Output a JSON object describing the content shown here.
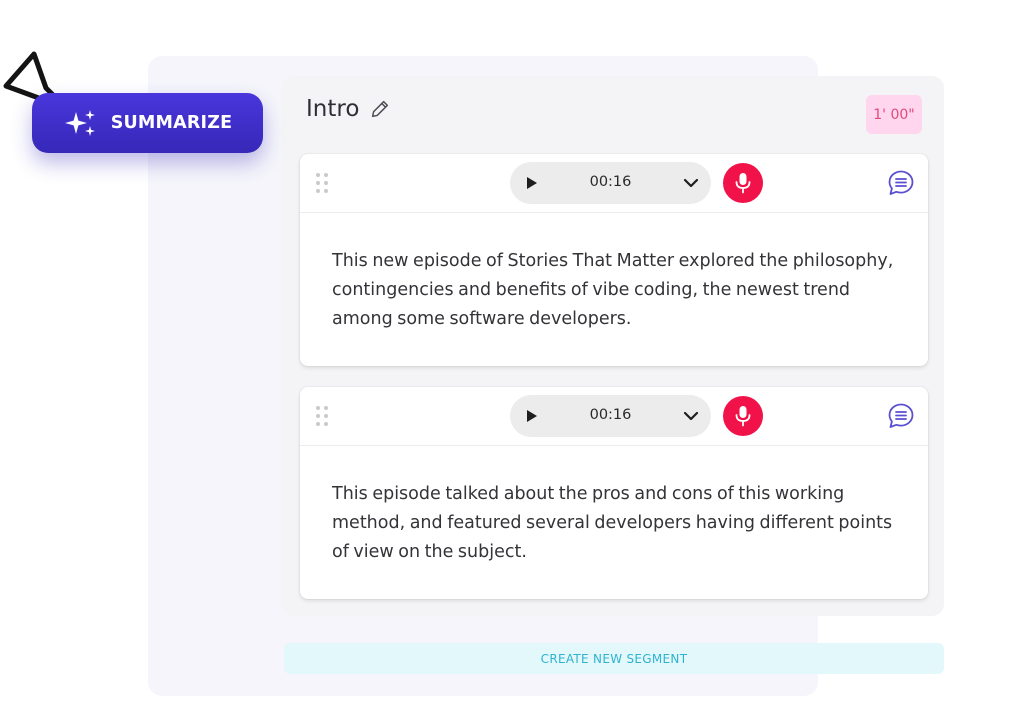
{
  "summarize_button": {
    "label": "SUMMARIZE",
    "icon": "sparkles-icon"
  },
  "section": {
    "title": "Intro",
    "duration": "1' 00\""
  },
  "segments": [
    {
      "time": "00:16",
      "text": "This new episode of Stories That Matter explored the philosophy, contingencies and benefits of vibe coding, the newest trend among some software developers."
    },
    {
      "time": "00:16",
      "text": "This episode talked about the pros and cons of this working method, and featured several developers having different points of view on the subject."
    }
  ],
  "create_segment_label": "CREATE NEW SEGMENT",
  "colors": {
    "primary": "#3f30c8",
    "mic": "#f2124a",
    "comment": "#5a4fd0",
    "badge_bg": "#ffd6ee",
    "badge_text": "#e04a7e",
    "create_bg": "#e3f8fb",
    "create_text": "#2fb3d0"
  }
}
